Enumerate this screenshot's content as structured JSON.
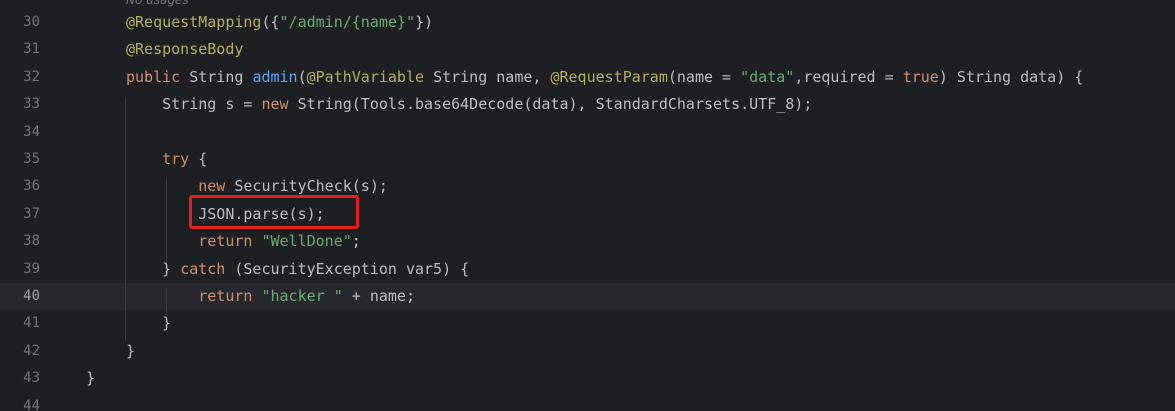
{
  "editor": {
    "partial_top": "No usages",
    "lines": [
      {
        "num": "30",
        "tokens": [
          [
            "ann",
            "@RequestMapping"
          ],
          [
            "plain",
            "({"
          ],
          [
            "str",
            "\"/admin/{name}\""
          ],
          [
            "plain",
            "})"
          ]
        ]
      },
      {
        "num": "31",
        "tokens": [
          [
            "ann",
            "@ResponseBody"
          ]
        ]
      },
      {
        "num": "32",
        "tokens": [
          [
            "kw",
            "public "
          ],
          [
            "plain",
            "String "
          ],
          [
            "fn",
            "admin"
          ],
          [
            "plain",
            "("
          ],
          [
            "ann",
            "@PathVariable "
          ],
          [
            "plain",
            "String name, "
          ],
          [
            "ann",
            "@RequestParam"
          ],
          [
            "plain",
            "(name = "
          ],
          [
            "str",
            "\"data\""
          ],
          [
            "plain",
            ",required = "
          ],
          [
            "kw",
            "true"
          ],
          [
            "plain",
            ") String data) {"
          ]
        ]
      },
      {
        "num": "33",
        "tokens": [
          [
            "plain",
            "    String s = "
          ],
          [
            "kw",
            "new "
          ],
          [
            "plain",
            "String(Tools.base64Decode(data), StandardCharsets."
          ],
          [
            "plain",
            "UTF_8"
          ],
          [
            "plain",
            ");"
          ]
        ]
      },
      {
        "num": "34",
        "tokens": []
      },
      {
        "num": "35",
        "tokens": [
          [
            "plain",
            "    "
          ],
          [
            "kw",
            "try "
          ],
          [
            "plain",
            "{"
          ]
        ]
      },
      {
        "num": "36",
        "tokens": [
          [
            "plain",
            "        "
          ],
          [
            "kw",
            "new "
          ],
          [
            "plain",
            "SecurityCheck(s);"
          ]
        ]
      },
      {
        "num": "37",
        "tokens": [
          [
            "plain",
            "        JSON.parse(s);"
          ]
        ]
      },
      {
        "num": "38",
        "tokens": [
          [
            "plain",
            "        "
          ],
          [
            "kw",
            "return "
          ],
          [
            "str",
            "\"WellDone\""
          ],
          [
            "plain",
            ";"
          ]
        ]
      },
      {
        "num": "39",
        "tokens": [
          [
            "plain",
            "    } "
          ],
          [
            "kw",
            "catch "
          ],
          [
            "plain",
            "(SecurityException var5) {"
          ]
        ]
      },
      {
        "num": "40",
        "tokens": [
          [
            "plain",
            "        "
          ],
          [
            "kw",
            "return "
          ],
          [
            "str",
            "\"hacker \""
          ],
          [
            "plain",
            " + name;"
          ]
        ],
        "current": true
      },
      {
        "num": "41",
        "tokens": [
          [
            "plain",
            "    }"
          ]
        ]
      },
      {
        "num": "42",
        "tokens": [
          [
            "plain",
            "}"
          ]
        ]
      },
      {
        "num": "43",
        "tokens": [
          [
            "plain",
            "}"
          ]
        ]
      },
      {
        "num": "44",
        "tokens": []
      }
    ]
  },
  "colors": {
    "background": "#1e1f22",
    "keyword": "#cf8e6d",
    "string": "#6aab73",
    "annotation": "#b3ae60",
    "function": "#56a8f5",
    "highlight_box": "#e5201e"
  }
}
